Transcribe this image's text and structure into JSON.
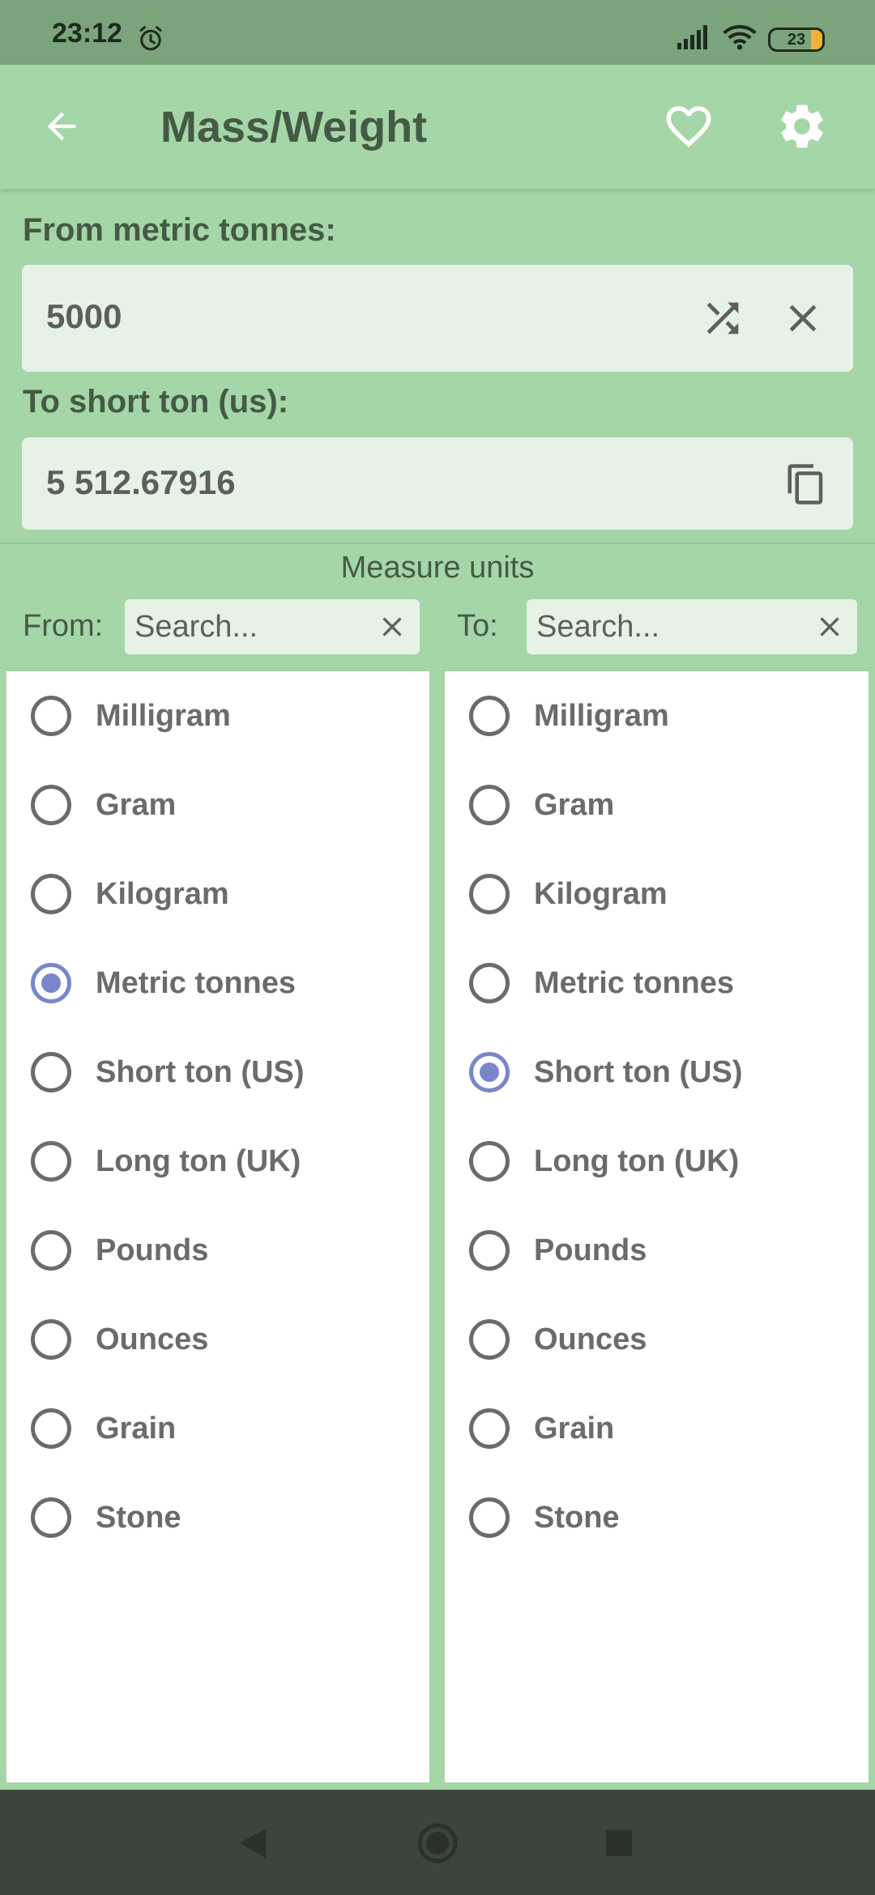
{
  "status_bar": {
    "time": "23:12",
    "battery": "23",
    "icons": [
      "alarm-icon",
      "signal-icon",
      "wifi-icon",
      "battery-icon"
    ]
  },
  "app_bar": {
    "title": "Mass/Weight",
    "icons": [
      "back-arrow-icon",
      "heart-icon",
      "gear-icon"
    ]
  },
  "converter": {
    "from_label": "From metric tonnes:",
    "from_value": "5000",
    "to_label": "To short ton (us):",
    "to_value": "5 512.67916",
    "icons": [
      "shuffle-icon",
      "close-icon",
      "copy-icon"
    ]
  },
  "units": {
    "header": "Measure units",
    "from_search_label": "From:",
    "to_search_label": "To:",
    "search_placeholder": "Search...",
    "items": [
      "Milligram",
      "Gram",
      "Kilogram",
      "Metric tonnes",
      "Short ton (US)",
      "Long ton (UK)",
      "Pounds",
      "Ounces",
      "Grain",
      "Stone"
    ],
    "from_selected": "Metric tonnes",
    "to_selected": "Short ton (US)"
  },
  "colors": {
    "background": "#a5d6a7",
    "status_bar": "#7ba47c",
    "field": "#e6f2e6",
    "accent_radio": "#7986cb",
    "text": "#455a46",
    "nav_bar": "#3c453c"
  }
}
